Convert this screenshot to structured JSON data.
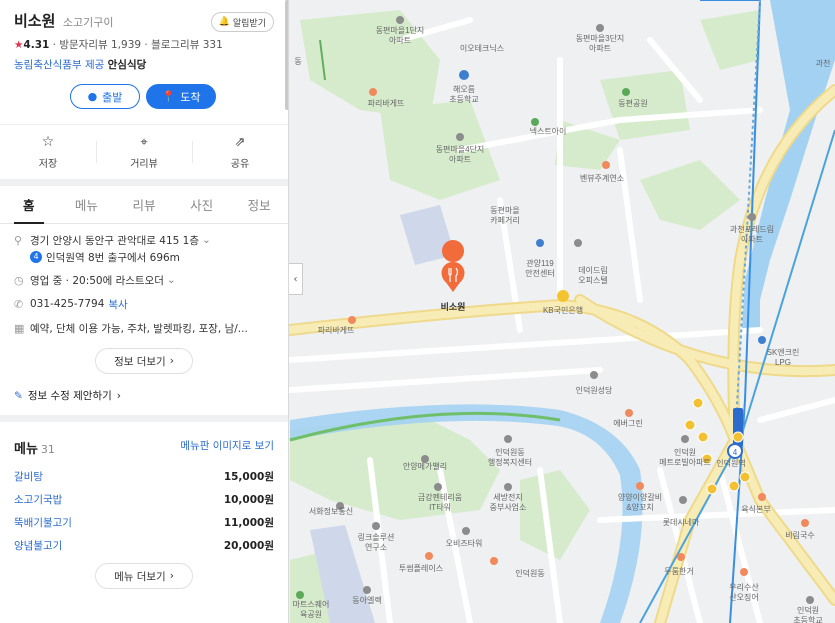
{
  "place": {
    "name": "비소원",
    "category": "소고기구이",
    "alarm_label": "알림받기",
    "rating": "4.31",
    "visitor_reviews": "방문자리뷰 1,939",
    "blog_reviews": "블로그리뷰 331",
    "cert_prefix": "농림축산식품부 제공",
    "cert_badge": "안심식당",
    "depart_label": "출발",
    "arrive_label": "도착"
  },
  "actions": [
    {
      "label": "저장",
      "icon": "star-icon"
    },
    {
      "label": "거리뷰",
      "icon": "pin-icon"
    },
    {
      "label": "공유",
      "icon": "share-icon"
    }
  ],
  "tabs": [
    "홈",
    "메뉴",
    "리뷰",
    "사진",
    "정보"
  ],
  "info": {
    "address": "경기 안양시 동안구 관악대로 415 1층",
    "station_num": "4",
    "station": "인덕원역 8번 출구에서 696m",
    "hours": "영업 중 · 20:50에 라스트오더",
    "phone": "031-425-7794",
    "copy_label": "복사",
    "amenities": "예약, 단체 이용 가능, 주차, 발렛파킹, 포장, 남/...",
    "more_label": "정보 더보기",
    "suggest_label": "정보 수정 제안하기"
  },
  "menu": {
    "title": "메뉴",
    "count": "31",
    "image_link": "메뉴판 이미지로 보기",
    "items": [
      {
        "name": "갈비탕",
        "price": "15,000원"
      },
      {
        "name": "소고기국밥",
        "price": "10,000원"
      },
      {
        "name": "뚝배기불고기",
        "price": "11,000원"
      },
      {
        "name": "양념불고기",
        "price": "20,000원"
      }
    ],
    "more_label": "메뉴 더보기"
  },
  "map": {
    "marker_label": "비소원",
    "labels": [
      {
        "t": "동편마을1단지\n아파트"
      },
      {
        "t": "동편마을3단지\n아파트"
      },
      {
        "t": "이오테크닉스"
      },
      {
        "t": "해오름\n초등학교"
      },
      {
        "t": "파리바게뜨"
      },
      {
        "t": "동편공원"
      },
      {
        "t": "넥스트아이"
      },
      {
        "t": "동편마을4단지\n아파트"
      },
      {
        "t": "벤뷰주계연소"
      },
      {
        "t": "동편마을\n카페거리"
      },
      {
        "t": "관양119\n안전센터"
      },
      {
        "t": "데이드림\n오피스텔"
      },
      {
        "t": "과천포레드림\n아파트"
      },
      {
        "t": "KB국민은행"
      },
      {
        "t": "파리바게뜨"
      },
      {
        "t": "SK엔크린\nLPG"
      },
      {
        "t": "인덕원성당"
      },
      {
        "t": "에버그린"
      },
      {
        "t": "인덕원동\n행정복지센터"
      },
      {
        "t": "인덕원\n메트로빌아파트"
      },
      {
        "t": "인덕원역"
      },
      {
        "t": "안양메가밸리"
      },
      {
        "t": "금강펜테리움\nIT타워"
      },
      {
        "t": "세방전지\n중부사업소"
      },
      {
        "t": "서화정보통신"
      },
      {
        "t": "양양이양갈비\n&양꼬치"
      },
      {
        "t": "롯데시네마"
      },
      {
        "t": "육식본부"
      },
      {
        "t": "링크솔루션\n연구소"
      },
      {
        "t": "오비즈타워"
      },
      {
        "t": "투썸플레이스"
      },
      {
        "t": "인덕원동"
      },
      {
        "t": "두룸한거"
      },
      {
        "t": "우리수산\n산오징어"
      },
      {
        "t": "동아엘렉"
      },
      {
        "t": "마트스퀘어\n육공원"
      },
      {
        "t": "인덕원\n초등학교"
      },
      {
        "t": "비림국수"
      },
      {
        "t": "과천"
      },
      {
        "t": "동"
      }
    ]
  },
  "colors": {
    "accent": "#1e74e8",
    "marker": "#f26b3a",
    "road": "#f6e9a8",
    "green": "#cfe8c4",
    "water": "#9fd0f4"
  }
}
